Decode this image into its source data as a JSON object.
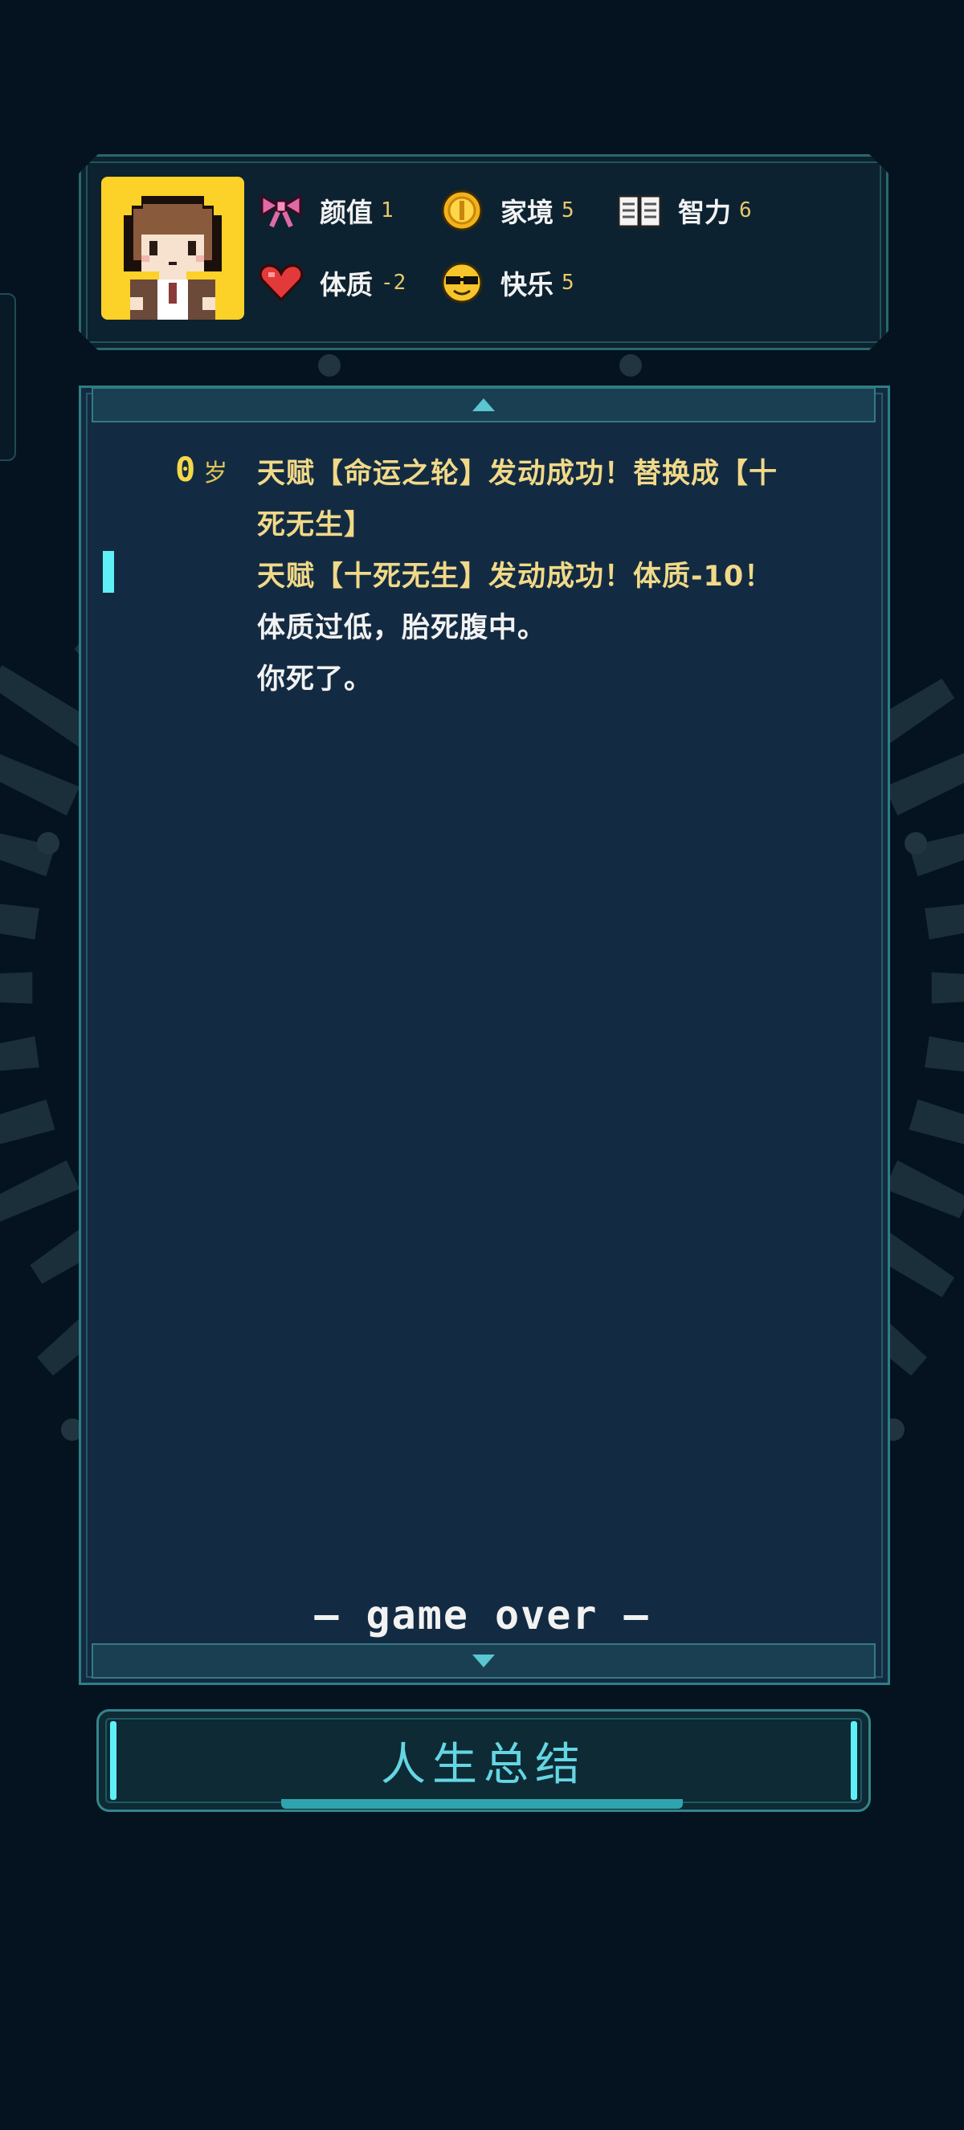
{
  "stats": [
    {
      "label": "颜值",
      "value": "1",
      "icon": "bow-icon"
    },
    {
      "label": "家境",
      "value": "5",
      "icon": "coin-icon"
    },
    {
      "label": "智力",
      "value": "6",
      "icon": "book-icon"
    },
    {
      "label": "体质",
      "value": "-2",
      "icon": "heart-icon"
    },
    {
      "label": "快乐",
      "value": "5",
      "icon": "sunglasses-face-icon"
    }
  ],
  "log": {
    "age_number": "0",
    "age_unit": "岁",
    "lines": [
      "天赋【命运之轮】发动成功！替换成【十",
      "死无生】",
      "天赋【十死无生】发动成功！体质-10！",
      "体质过低，胎死腹中。",
      "你死了。"
    ],
    "game_over_text": "— game over —"
  },
  "summary_button_label": "人生总结",
  "colors": {
    "accent_cyan": "#5ef0f6",
    "gold_text": "#f1d988",
    "frame": "#2d7f84",
    "panel_bg": "#132b42"
  }
}
